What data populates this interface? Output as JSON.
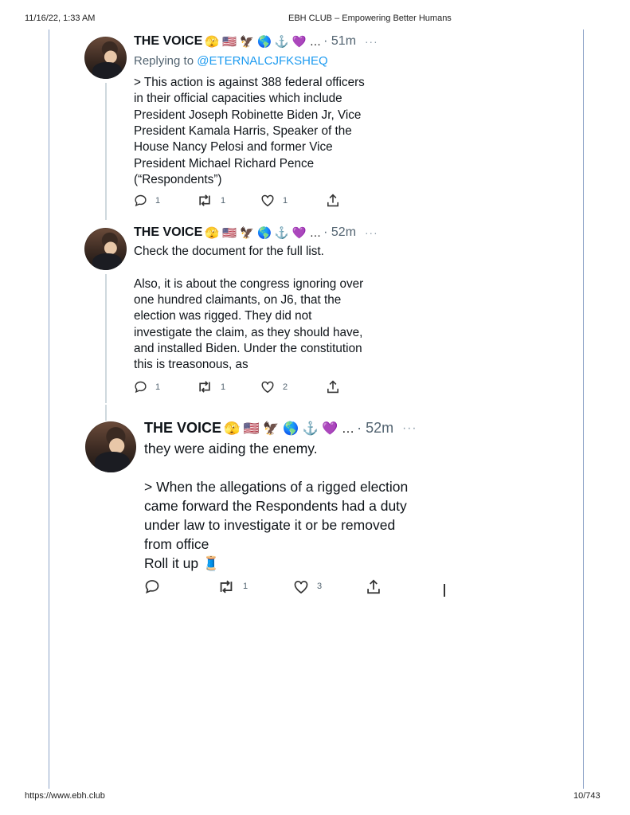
{
  "print_header": {
    "timestamp": "11/16/22, 1:33 AM",
    "title": "EBH CLUB – Empowering Better Humans"
  },
  "print_footer": {
    "url": "https://www.ebh.club",
    "page": "10/743"
  },
  "colors": {
    "link": "#1d9bf0",
    "muted": "#536471",
    "text": "#0f1419",
    "rule": "#8ea3c8"
  },
  "tweets": [
    {
      "author": "THE VOICE",
      "emojis": "🫣 🇺🇸 🦅 🌎 ⚓ 💜 …",
      "time": "· 51m",
      "more": "···",
      "replying_prefix": "Replying to",
      "replying_handle": "@ETERNALCJFKSHEQ",
      "lines": [
        "> This action is against 388 federal officers",
        "in their official capacities which include",
        "President Joseph Robinette Biden Jr, Vice",
        "President Kamala Harris, Speaker of the",
        "House Nancy Pelosi and former Vice",
        "President Michael Richard Pence",
        "(“Respondents”)"
      ],
      "actions": {
        "replies": "1",
        "retweets": "1",
        "likes": "1"
      }
    },
    {
      "author": "THE VOICE",
      "emojis": "🫣 🇺🇸 🦅 🌎 ⚓ 💜 …",
      "time": "· 52m",
      "more": "···",
      "paragraph1": "Check the document for the full list.",
      "lines": [
        "Also, it is about the congress ignoring over",
        "one hundred claimants, on J6, that the",
        "election was rigged. They did not",
        "investigate the claim, as they should have,",
        "and installed Biden. Under the constitution",
        "this is treasonous, as"
      ],
      "actions": {
        "replies": "1",
        "retweets": "1",
        "likes": "2"
      }
    },
    {
      "author": "THE VOICE",
      "emojis": "🫣 🇺🇸 🦅 🌎 ⚓ 💜 …",
      "time": "· 52m",
      "more": "···",
      "paragraph1": "they were aiding the enemy.",
      "lines": [
        "> When the allegations of a rigged election",
        "came forward the Respondents had a duty",
        "under law to investigate it or be removed",
        "from office",
        "Roll it up 🧵"
      ],
      "actions": {
        "replies": "",
        "retweets": "1",
        "likes": "3"
      }
    }
  ]
}
